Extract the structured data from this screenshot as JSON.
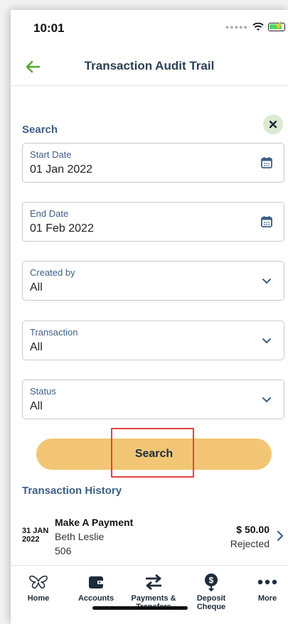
{
  "status_bar": {
    "time": "10:01"
  },
  "header": {
    "title": "Transaction Audit Trail"
  },
  "search": {
    "heading": "Search",
    "start_date": {
      "label": "Start Date",
      "value": "01 Jan 2022"
    },
    "end_date": {
      "label": "End Date",
      "value": "01 Feb 2022"
    },
    "created_by": {
      "label": "Created by",
      "value": "All"
    },
    "transaction": {
      "label": "Transaction",
      "value": "All"
    },
    "status": {
      "label": "Status",
      "value": "All"
    },
    "button_label": "Search"
  },
  "history": {
    "heading": "Transaction History",
    "items": [
      {
        "date_day": "31 JAN",
        "date_year": "2022",
        "title": "Make A Payment",
        "name": "Beth Leslie",
        "ref": "506",
        "amount": "$ 50.00",
        "status": "Rejected"
      }
    ]
  },
  "tab_bar": {
    "items": [
      {
        "label": "Home",
        "icon": "butterfly-icon"
      },
      {
        "label": "Accounts",
        "icon": "wallet-icon"
      },
      {
        "label": "Payments & Transfers",
        "icon": "transfer-arrows-icon"
      },
      {
        "label": "Deposit Cheque",
        "icon": "deposit-icon"
      },
      {
        "label": "More",
        "icon": "more-dots-icon"
      }
    ]
  },
  "colors": {
    "accent": "#3d5e86",
    "button": "#f2c675",
    "back_arrow": "#5aa832",
    "highlight": "#e0453d"
  }
}
